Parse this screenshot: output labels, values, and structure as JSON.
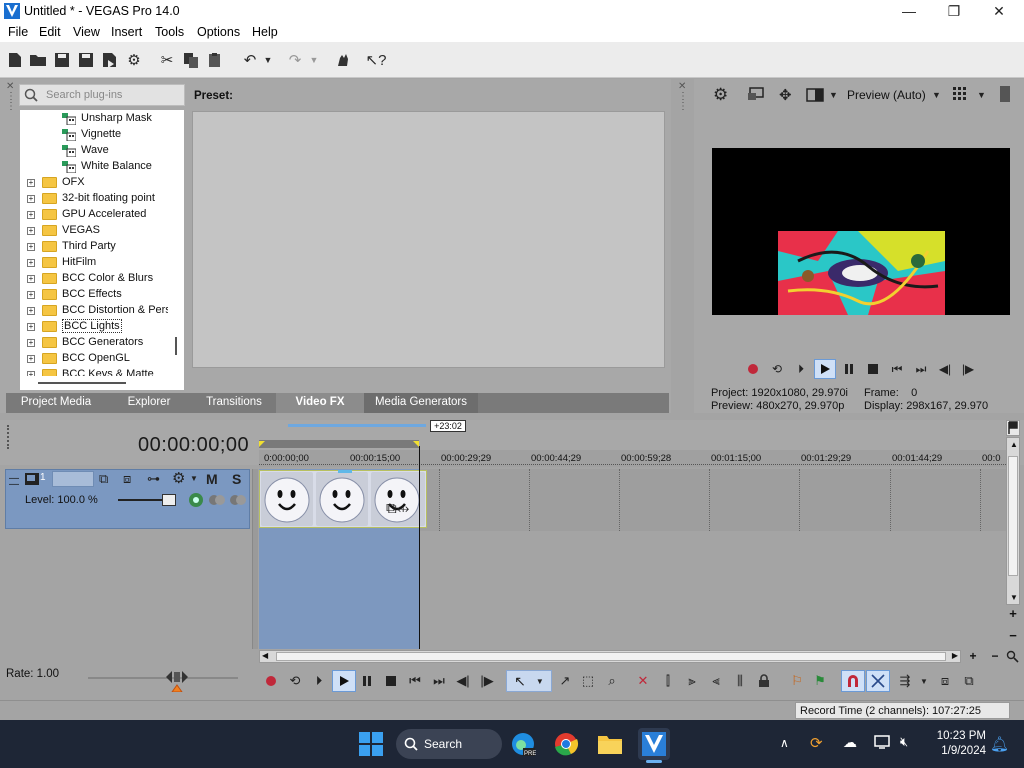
{
  "window": {
    "title": "Untitled * - VEGAS Pro 14.0",
    "minimize": "—",
    "maximize": "❐",
    "close": "✕"
  },
  "menu": {
    "items": [
      "File",
      "Edit",
      "View",
      "Insert",
      "Tools",
      "Options",
      "Help"
    ]
  },
  "plugins": {
    "search_placeholder": "Search plug-ins",
    "tree": [
      {
        "label": "Unsharp Mask",
        "kind": "fx"
      },
      {
        "label": "Vignette",
        "kind": "fx"
      },
      {
        "label": "Wave",
        "kind": "fx"
      },
      {
        "label": "White Balance",
        "kind": "fx"
      },
      {
        "label": "OFX",
        "kind": "folder"
      },
      {
        "label": "32-bit floating point",
        "kind": "folder"
      },
      {
        "label": "GPU Accelerated",
        "kind": "folder"
      },
      {
        "label": "VEGAS",
        "kind": "folder"
      },
      {
        "label": "Third Party",
        "kind": "folder"
      },
      {
        "label": "HitFilm",
        "kind": "folder"
      },
      {
        "label": "BCC Color & Blurs",
        "kind": "folder"
      },
      {
        "label": "BCC Effects",
        "kind": "folder"
      },
      {
        "label": "BCC Distortion & Persp",
        "kind": "folder"
      },
      {
        "label": "BCC Lights",
        "kind": "folder",
        "selected": true
      },
      {
        "label": "BCC Generators",
        "kind": "folder"
      },
      {
        "label": "BCC OpenGL",
        "kind": "folder"
      },
      {
        "label": "BCC Keys & Matte",
        "kind": "folder"
      }
    ],
    "preset_label": "Preset:"
  },
  "tabs": [
    {
      "label": "Project Media",
      "active": false
    },
    {
      "label": "Explorer",
      "active": false
    },
    {
      "label": "Transitions",
      "active": false
    },
    {
      "label": "Video FX",
      "active": true
    },
    {
      "label": "Media Generators",
      "active": false
    }
  ],
  "preview": {
    "mode": "Preview (Auto)",
    "project_label": "Project:",
    "project_value": "1920x1080, 29.970i",
    "frame_label": "Frame:",
    "frame_value": "0",
    "preview_label": "Preview:",
    "preview_value": "480x270, 29.970p",
    "display_label": "Display:",
    "display_value": "298x167, 29.970"
  },
  "timeline": {
    "timecode": "00:00:00;00",
    "selection_length": "+23:02",
    "ruler": [
      "0:00:00;00",
      "00:00:15;00",
      "00:00:29;29",
      "00:00:44;29",
      "00:00:59;28",
      "00:01:15;00",
      "00:01:29;29",
      "00:01:44;29",
      "00:0"
    ],
    "track_number": "1",
    "track_level": "Level: 100.0 %",
    "mute": "M",
    "solo": "S",
    "rate": "Rate: 1.00"
  },
  "status": {
    "record_time": "Record Time (2 channels): 107:27:25"
  },
  "taskbar": {
    "search": "Search",
    "time": "10:23 PM",
    "date": "1/9/2024"
  },
  "colors": {
    "track_blue": "#7b98c1",
    "taskbar": "#1e2636",
    "folder": "#f5c542"
  }
}
